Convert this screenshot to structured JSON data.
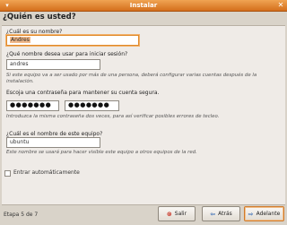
{
  "window": {
    "title": "Instalar"
  },
  "page": {
    "heading": "¿Quién es usted?"
  },
  "name_section": {
    "label": "¿Cuál es su nombre?",
    "value": "Andres"
  },
  "login_section": {
    "label": "¿Qué nombre desea usar para iniciar sesión?",
    "value": "andres",
    "hint": "Si este equipo va a ser usado por más de una persona, deberá configurar varias cuentas después de la instalación."
  },
  "password_section": {
    "label": "Escoja una contraseña para mantener su cuenta segura.",
    "password_dots": "●●●●●●●",
    "confirm_dots": "●●●●●●●",
    "hint": "Introduzca la misma contraseña dos veces, para así verificar posibles errores de tecleo."
  },
  "computer_section": {
    "label": "¿Cuál es el nombre de este equipo?",
    "value": "ubuntu",
    "hint": "Este nombre se usará para hacer visible este equipo a otros equipos de la red."
  },
  "autologin": {
    "label": "Entrar automáticamente",
    "checked": false
  },
  "footer": {
    "step": "Etapa 5 de 7",
    "quit_label": "Salir",
    "back_label": "Atrás",
    "forward_label": "Adelante"
  },
  "colors": {
    "titlebar": "#d97a2a",
    "focus": "#e08a2c",
    "background": "#efebe7"
  }
}
